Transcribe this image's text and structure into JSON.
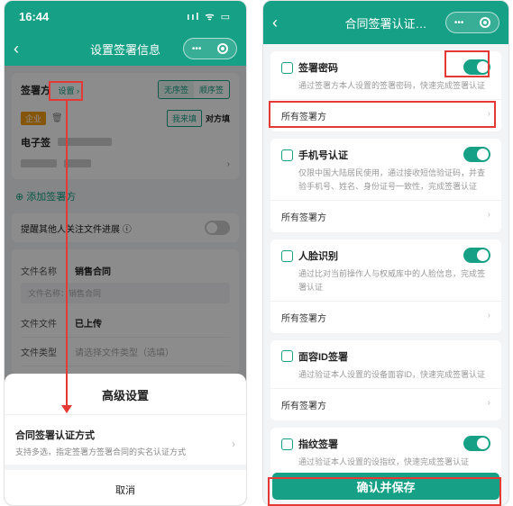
{
  "left": {
    "status_time": "16:44",
    "status_icons": "ııl ᯤ ▭",
    "nav_title": "设置签署信息",
    "capsule_dots": "•••",
    "signer_label": "签署方",
    "signer_settings": "设置 ›",
    "order_unordered": "无序签",
    "order_ordered": "顺序签",
    "org_tag": "企业",
    "role_our": "我来填",
    "role_other": "对方填",
    "email_label": "电子签",
    "add_signer": "⊕ 添加签署方",
    "remind_label": "提醒其他人关注文件进展 ⓘ",
    "file_name_label": "文件名称",
    "file_name_value": "销售合同",
    "file_name_hint": "文件名称：销售合同",
    "file_file_label": "文件文件",
    "file_file_value": "已上传",
    "file_type_label": "文件类型",
    "file_type_value": "请选择文件类型（选填）",
    "sheet_title": "高级设置",
    "sheet_item_title": "合同签署认证方式",
    "sheet_item_desc": "支持多选，指定签署方签署合同的实名认证方式",
    "sheet_cancel": "取消"
  },
  "right": {
    "nav_title": "合同签署认证…",
    "capsule_dots": "•••",
    "methods": [
      {
        "title": "签署密码",
        "desc": "通过签署方本人设置的签署密码，快速完成签署认证",
        "row": "所有签署方"
      },
      {
        "title": "手机号认证",
        "desc": "仅限中国大陆居民使用，通过接收短信验证码，并查验手机号、姓名、身份证号一致性，完成签署认证",
        "row": "所有签署方"
      },
      {
        "title": "人脸识别",
        "desc": "通过比对当前操作人与权威库中的人脸信息，完成签署认证",
        "row": "所有签署方"
      },
      {
        "title": "面容ID签署",
        "desc": "通过验证本人设置的设备面容ID，快速完成签署认证",
        "row": "所有签署方"
      },
      {
        "title": "指纹签署",
        "desc": "通过验证本人设置的设指纹，快速完成签署认证",
        "row": ""
      }
    ],
    "confirm": "确认并保存"
  },
  "colors": {
    "primary": "#16a085",
    "highlight": "#e53935"
  }
}
